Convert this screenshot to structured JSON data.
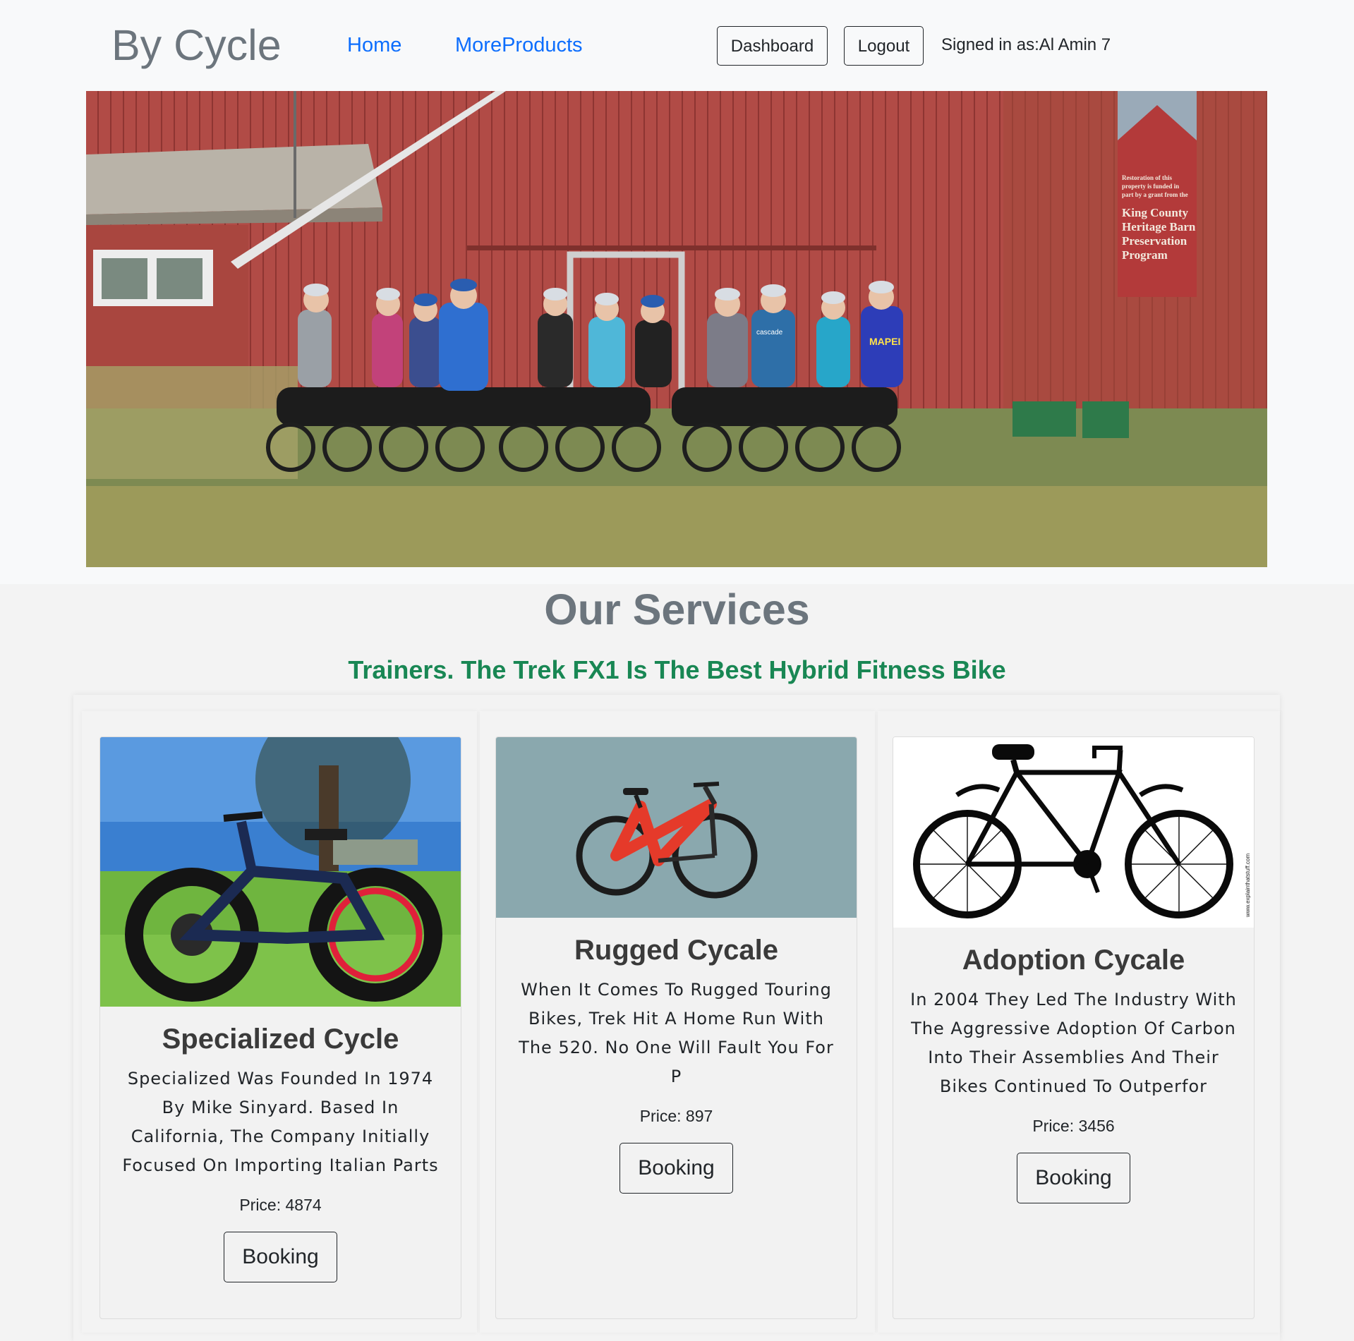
{
  "navbar": {
    "brand": "By Cycle",
    "links": [
      "Home",
      "MoreProducts"
    ],
    "dashboard_label": "Dashboard",
    "logout_label": "Logout",
    "signed_in_text": "Signed in as:Al Amin 7"
  },
  "hero": {
    "image": "group-of-cyclists-in-front-of-red-barn",
    "sign_text": [
      "Restoration of this",
      "property is funded in",
      "part by a grant from the",
      "King County",
      "Heritage Barn",
      "Preservation",
      "Program"
    ],
    "jersey_text": [
      "cascade",
      "MAPEI"
    ]
  },
  "services": {
    "title": "Our Services",
    "subtitle": "Trainers. The Trek FX1 Is The Best Hybrid Fitness Bike",
    "cards": [
      {
        "title": "Specialized Cycle",
        "description": "Specialized Was Founded In 1974 By Mike Sinyard. Based In California, The Company Initially Focused On Importing Italian Parts",
        "price_label": "Price: 4874",
        "button_label": "Booking",
        "image": "fat-tire-electric-bike-photo"
      },
      {
        "title": "Rugged Cycale",
        "description": "When It Comes To Rugged Touring Bikes, Trek Hit A Home Run With The 520. No One Will Fault You For P",
        "price_label": "Price: 897",
        "button_label": "Booking",
        "image": "red-electric-bike-photo"
      },
      {
        "title": "Adoption Cycale",
        "description": "In 2004 They Led The Industry With The Aggressive Adoption Of Carbon Into Their Assemblies And Their Bikes Continued To Outperfor",
        "price_label": "Price: 3456",
        "button_label": "Booking",
        "image": "bicycle-line-drawing",
        "image_watermark": "www.explainthatstuff.com"
      }
    ]
  },
  "colors": {
    "brand_gray": "#6c757d",
    "link_blue": "#0d6efd",
    "subtitle_green": "#198754",
    "barn_red": "#b04a45"
  }
}
